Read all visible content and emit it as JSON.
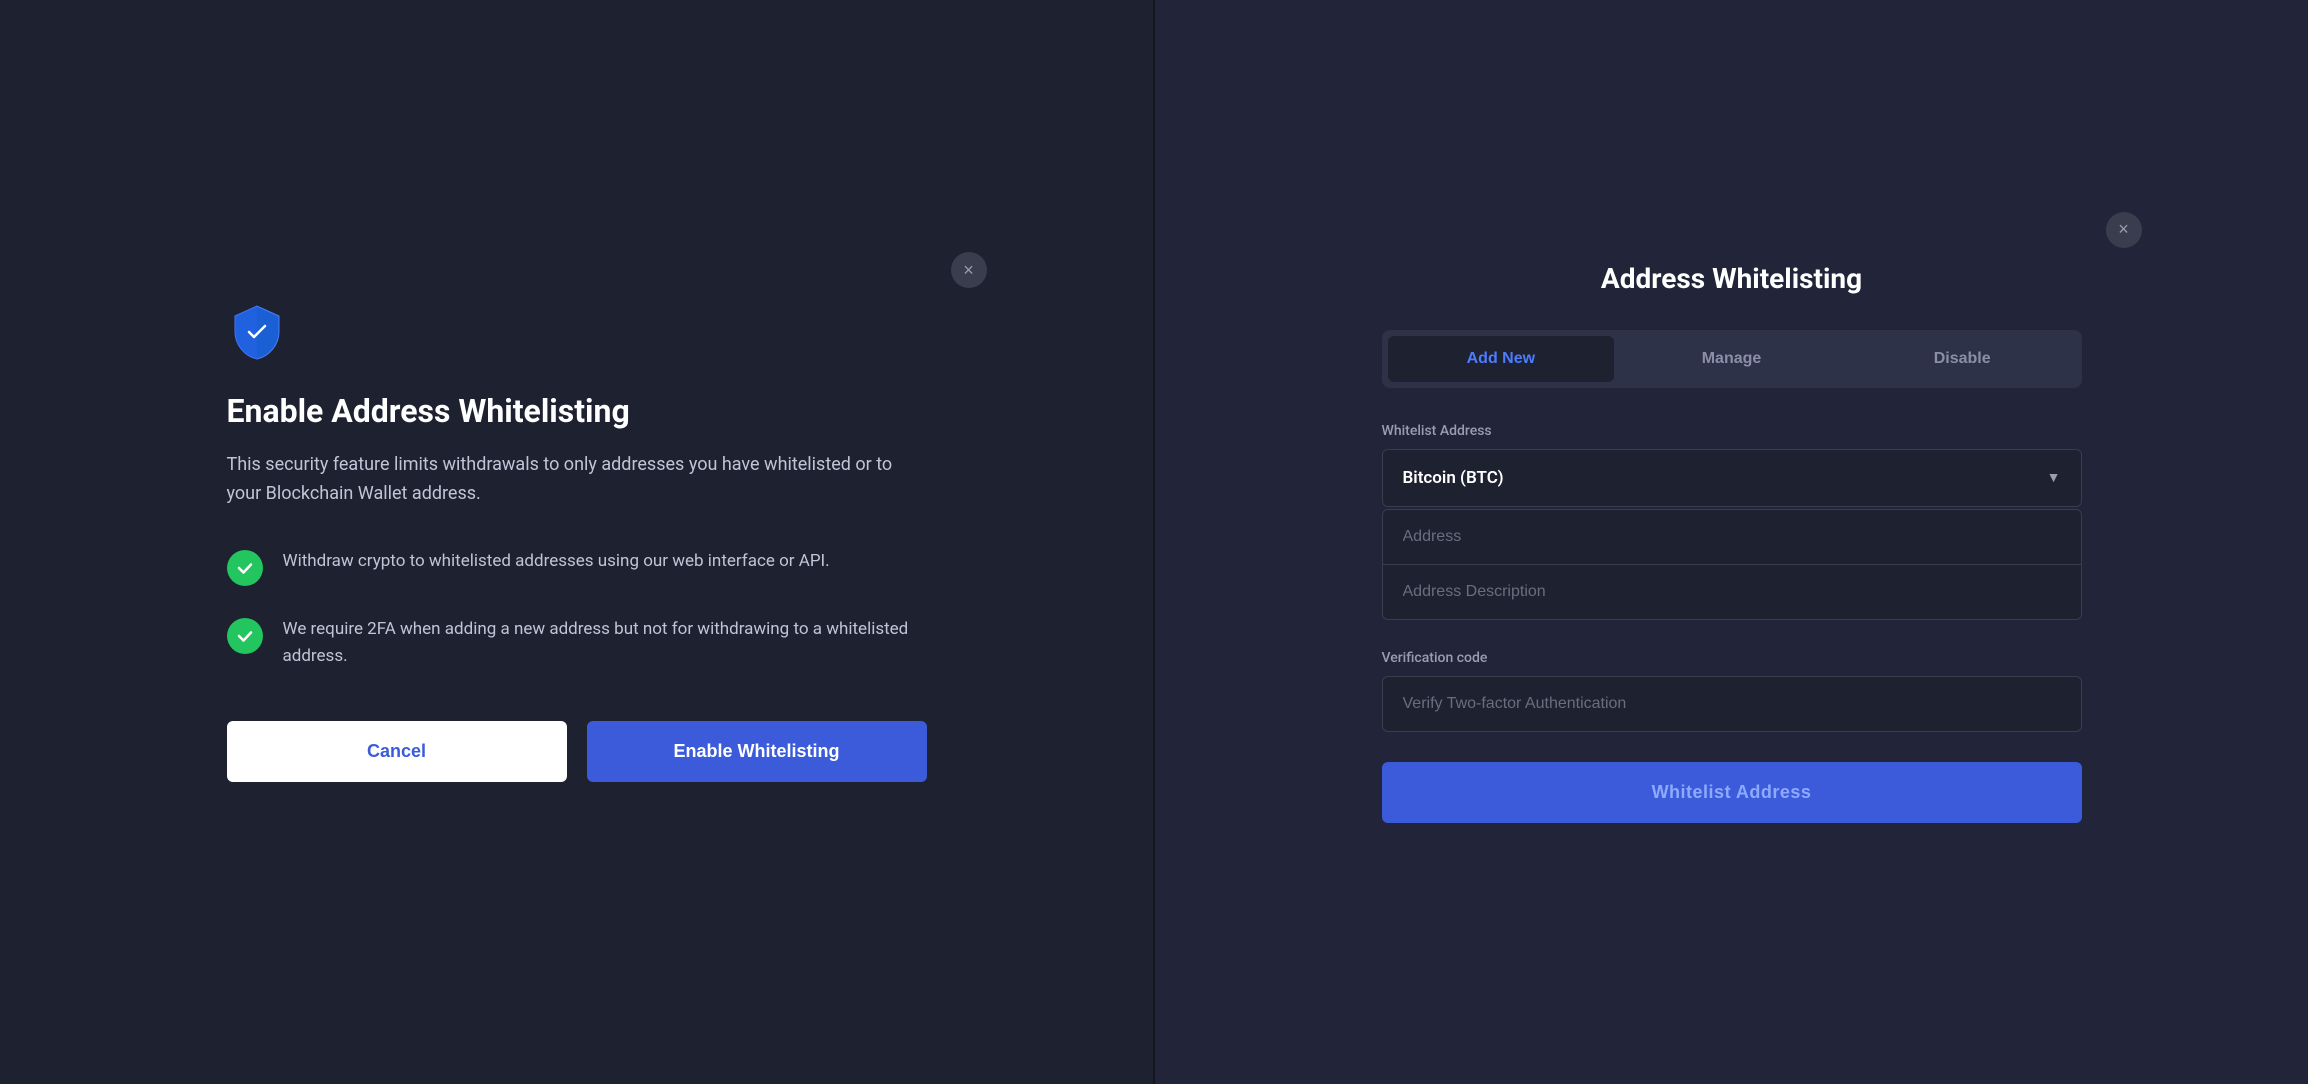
{
  "left_panel": {
    "close_label": "×",
    "title": "Enable Address Whitelisting",
    "description": "This security feature limits withdrawals to only addresses you have whitelisted or to your Blockchain Wallet address.",
    "features": [
      {
        "id": "feature-1",
        "text": "Withdraw crypto to whitelisted addresses using our web interface or API."
      },
      {
        "id": "feature-2",
        "text": "We require 2FA when adding a new address but not for withdrawing to a whitelisted address."
      }
    ],
    "cancel_label": "Cancel",
    "enable_label": "Enable Whitelisting"
  },
  "right_panel": {
    "close_label": "×",
    "title": "Address Whitelisting",
    "tabs": [
      {
        "id": "add-new",
        "label": "Add New",
        "active": true
      },
      {
        "id": "manage",
        "label": "Manage",
        "active": false
      },
      {
        "id": "disable",
        "label": "Disable",
        "active": false
      }
    ],
    "whitelist_address_label": "Whitelist Address",
    "currency_value": "Bitcoin (BTC)",
    "address_placeholder": "Address",
    "address_description_placeholder": "Address Description",
    "verification_label": "Verification code",
    "verification_placeholder": "Verify Two-factor Authentication",
    "whitelist_button_label": "Whitelist Address"
  }
}
